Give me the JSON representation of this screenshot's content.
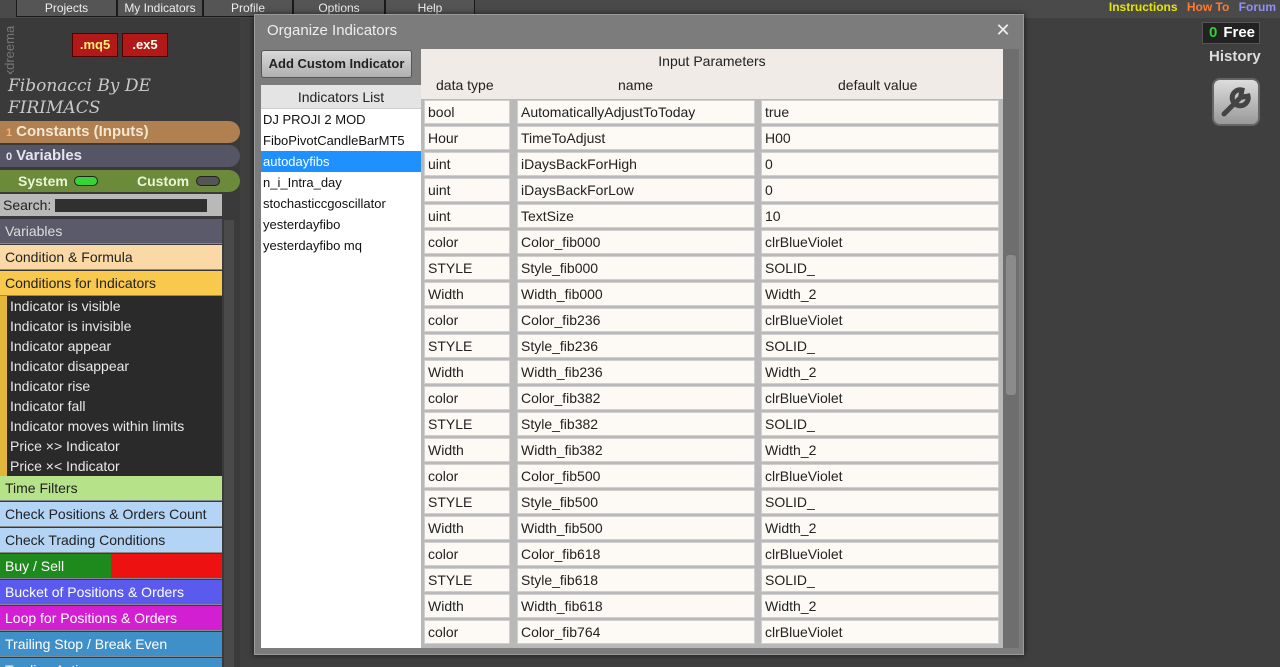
{
  "top_menu": {
    "tabs": [
      "Projects",
      "My Indicators",
      "Profile",
      "Options",
      "Help"
    ],
    "links": [
      {
        "label": "Instructions",
        "color": "#e6e600"
      },
      {
        "label": "How To",
        "color": "#ff7a2e"
      },
      {
        "label": "Forum",
        "color": "#8f8fff"
      }
    ]
  },
  "brand_vertical": "fxdreema",
  "format_buttons": [
    ".mq5",
    ".ex5"
  ],
  "sidebar": {
    "strategy_title_line1": "Fibonacci By DE",
    "strategy_title_line2": "FIRIMACS",
    "constants": {
      "count": "1",
      "label": "Constants (Inputs)"
    },
    "variables": {
      "count": "0",
      "label": "Variables"
    },
    "system_label": "System",
    "custom_label": "Custom",
    "search_label": "Search:",
    "categories": {
      "variables": "Variables",
      "condition_formula": "Condition & Formula",
      "conditions_indicators": "Conditions for Indicators",
      "time_filters": "Time Filters",
      "check_positions": "Check Positions & Orders Count",
      "check_trading": "Check Trading Conditions",
      "buy_sell": "Buy / Sell",
      "bucket": "Bucket of Positions & Orders",
      "loop": "Loop for Positions & Orders",
      "trailing": "Trailing Stop / Break Even",
      "trading_actions": "Trading Actions"
    },
    "indicator_subitems": [
      "Indicator is visible",
      "Indicator is invisible",
      "Indicator appear",
      "Indicator disappear",
      "Indicator rise",
      "Indicator fall",
      "Indicator moves within limits",
      "Price ×> Indicator",
      "Price ×< Indicator"
    ]
  },
  "right_panel": {
    "free_count": "0",
    "free_label": "Free",
    "history_label": "History"
  },
  "dialog": {
    "title": "Organize Indicators",
    "add_button": "Add Custom Indicator",
    "indicators_list_header": "Indicators List",
    "indicators": [
      "DJ PROJI 2 MOD",
      "FiboPivotCandleBarMT5",
      "autodayfibs",
      "n_i_Intra_day",
      "stochasticcgoscillator",
      "yesterdayfibo",
      "yesterdayfibo mq"
    ],
    "selected_indicator_index": 2,
    "params_header": "Input Parameters",
    "col_type": "data type",
    "col_name": "name",
    "col_default": "default value",
    "params": [
      {
        "type": "bool",
        "name": "AutomaticallyAdjustToToday",
        "default": "true"
      },
      {
        "type": "Hour",
        "name": "TimeToAdjust",
        "default": "H00"
      },
      {
        "type": "uint",
        "name": "iDaysBackForHigh",
        "default": "0"
      },
      {
        "type": "uint",
        "name": "iDaysBackForLow",
        "default": "0"
      },
      {
        "type": "uint",
        "name": "TextSize",
        "default": "10"
      },
      {
        "type": "color",
        "name": "Color_fib000",
        "default": "clrBlueViolet"
      },
      {
        "type": "STYLE",
        "name": "Style_fib000",
        "default": "SOLID_"
      },
      {
        "type": "Width",
        "name": "Width_fib000",
        "default": "Width_2"
      },
      {
        "type": "color",
        "name": "Color_fib236",
        "default": "clrBlueViolet"
      },
      {
        "type": "STYLE",
        "name": "Style_fib236",
        "default": "SOLID_"
      },
      {
        "type": "Width",
        "name": "Width_fib236",
        "default": "Width_2"
      },
      {
        "type": "color",
        "name": "Color_fib382",
        "default": "clrBlueViolet"
      },
      {
        "type": "STYLE",
        "name": "Style_fib382",
        "default": "SOLID_"
      },
      {
        "type": "Width",
        "name": "Width_fib382",
        "default": "Width_2"
      },
      {
        "type": "color",
        "name": "Color_fib500",
        "default": "clrBlueViolet"
      },
      {
        "type": "STYLE",
        "name": "Style_fib500",
        "default": "SOLID_"
      },
      {
        "type": "Width",
        "name": "Width_fib500",
        "default": "Width_2"
      },
      {
        "type": "color",
        "name": "Color_fib618",
        "default": "clrBlueViolet"
      },
      {
        "type": "STYLE",
        "name": "Style_fib618",
        "default": "SOLID_"
      },
      {
        "type": "Width",
        "name": "Width_fib618",
        "default": "Width_2"
      },
      {
        "type": "color",
        "name": "Color_fib764",
        "default": "clrBlueViolet"
      }
    ]
  }
}
